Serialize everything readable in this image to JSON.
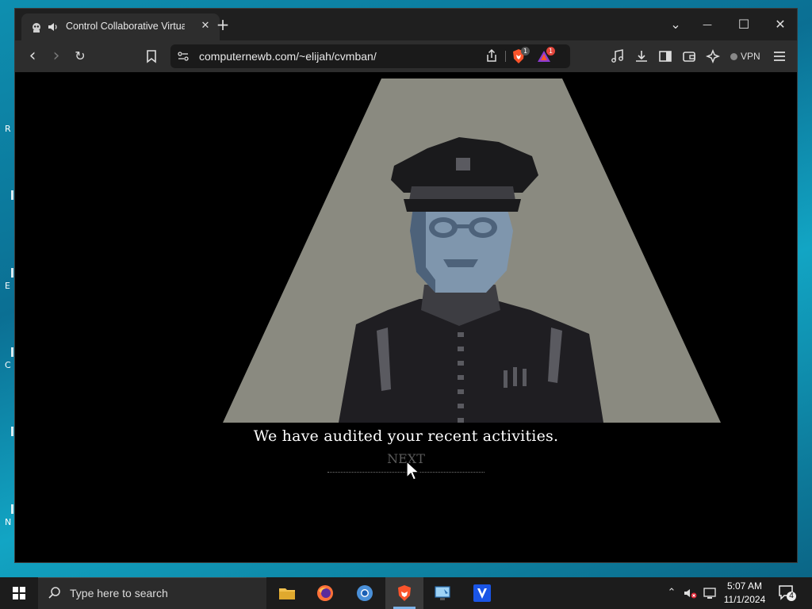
{
  "desktop": {
    "fragments": [
      "R",
      "E",
      "C",
      "N"
    ]
  },
  "browser": {
    "tab": {
      "title": "Control Collaborative Virtua",
      "close_glyph": "✕"
    },
    "new_tab_glyph": "+",
    "window_controls": {
      "dropdown": "⌄",
      "minimize": "—",
      "maximize": "☐",
      "close": "✕"
    },
    "toolbar": {
      "back": "‹",
      "forward": "›",
      "reload": "↻",
      "url": "computernewb.com/~elijah/cvmban/",
      "shields_count": "1",
      "rewards_count": "1",
      "vpn_label": "VPN"
    }
  },
  "game": {
    "dialogue": "We have audited your recent activities.",
    "next_label": "NEXT",
    "colors": {
      "spotlight": "#8a8a80",
      "uniform": "#1f1e22",
      "face": "#7f96ad",
      "face_shadow": "#4d627a",
      "cap": "#1a1a1c",
      "cap_band": "#3d3d42",
      "highlight": "#5a5a60"
    }
  },
  "taskbar": {
    "search_placeholder": "Type here to search",
    "time": "5:07 AM",
    "date": "11/1/2024",
    "notification_count": "4"
  }
}
